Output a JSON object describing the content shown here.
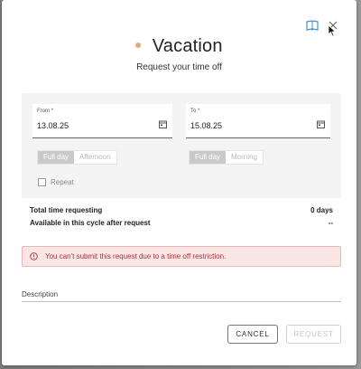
{
  "dialog": {
    "title": "Vacation",
    "subtitle": "Request your time off",
    "accent_color": "#e5a779"
  },
  "icons": {
    "top_left": "book-icon",
    "close": "close-icon"
  },
  "from": {
    "label": "From *",
    "value": "13.08.25",
    "options": [
      "Full day",
      "Afternoon"
    ],
    "selected": "Full day"
  },
  "to": {
    "label": "To *",
    "value": "15.08.25",
    "options": [
      "Full day",
      "Morning"
    ],
    "selected": "Full day"
  },
  "repeat": {
    "label": "Repeat",
    "checked": false
  },
  "summary": {
    "total_label": "Total time requesting",
    "total_value": "0 days",
    "available_label": "Available in this cycle after request",
    "available_value": "--"
  },
  "alert": {
    "text": "You can't submit this request due to a time off restriction.",
    "color": "#b03030"
  },
  "description": {
    "label": "Description",
    "value": ""
  },
  "buttons": {
    "cancel": "CANCEL",
    "request": "REQUEST"
  }
}
